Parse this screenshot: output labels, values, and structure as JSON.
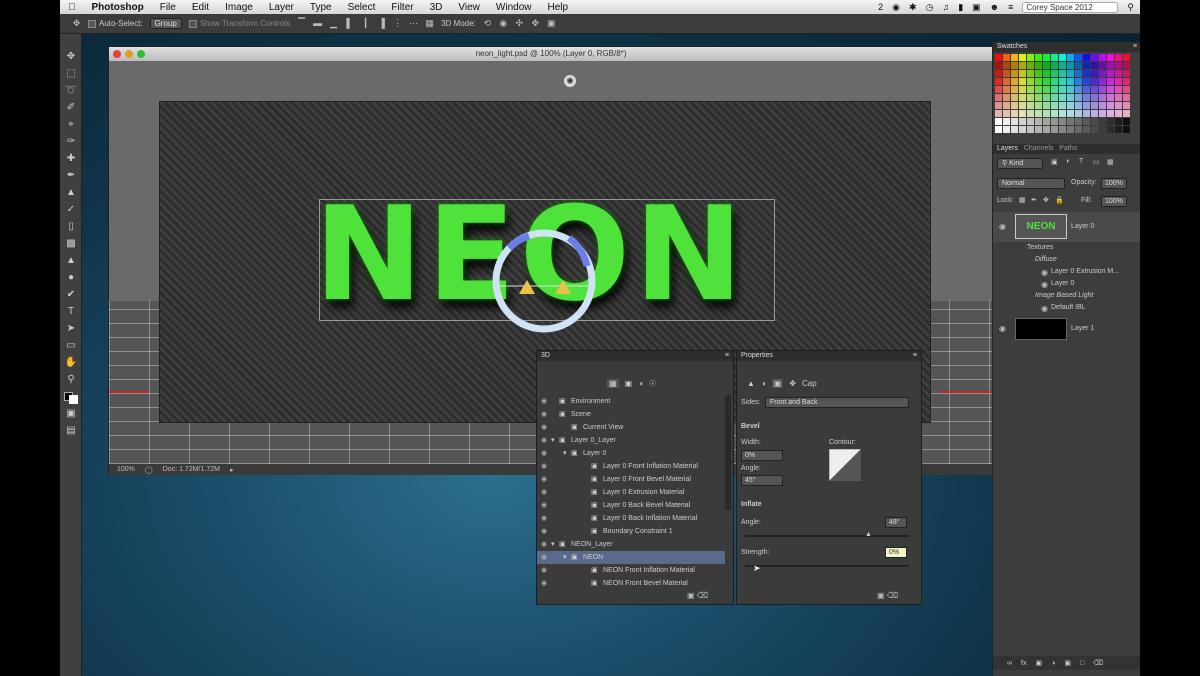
{
  "menubar": {
    "app": "Photoshop",
    "items": [
      "File",
      "Edit",
      "Image",
      "Layer",
      "Type",
      "Select",
      "Filter",
      "3D",
      "View",
      "Window",
      "Help"
    ],
    "badge": "2",
    "workspace": "Corey Space 2012"
  },
  "options": {
    "auto_select": "Auto-Select:",
    "group": "Group",
    "transform": "Show Transform Controls",
    "mode3d": "3D Mode:"
  },
  "document": {
    "title": "neon_light.psd @ 100% (Layer 0, RGB/8*)",
    "canvas_text": "NEON",
    "zoom": "100%",
    "doc_size": "Doc: 1.72M/1.72M"
  },
  "swatches": {
    "title": "Swatches"
  },
  "layers": {
    "tabs": [
      "Layers",
      "Channels",
      "Paths"
    ],
    "kind": "Kind",
    "blend": "Normal",
    "opacity_label": "Opacity:",
    "opacity": "100%",
    "lock_label": "Lock:",
    "fill_label": "Fill:",
    "fill": "100%",
    "rows": [
      {
        "name": "Layer 0",
        "thumb": "NEON"
      },
      {
        "name": "Textures"
      },
      {
        "name": "Diffuse"
      },
      {
        "name": "Layer 0 Extrusion M..."
      },
      {
        "name": "Layer 0"
      },
      {
        "name": "Image Based Light"
      },
      {
        "name": "Default IBL"
      },
      {
        "name": "Layer 1"
      }
    ]
  },
  "panel3d": {
    "title": "3D",
    "items": [
      "Environment",
      "Scene",
      "Current View",
      "Layer 0_Layer",
      "Layer 0",
      "Layer 0 Front Inflation Material",
      "Layer 0 Front Bevel Material",
      "Layer 0 Extrusion Material",
      "Layer 0 Back Bevel Material",
      "Layer 0 Back Inflation Material",
      "Boundary Constraint 1",
      "NEON_Layer",
      "NEON",
      "NEON Front Inflation Material",
      "NEON Front Bevel Material"
    ]
  },
  "properties": {
    "title": "Properties",
    "cap": "Cap",
    "sides_label": "Sides:",
    "sides": "Front and Back",
    "bevel": "Bevel",
    "width_label": "Width:",
    "width": "0%",
    "contour_label": "Contour:",
    "angle_label": "Angle:",
    "angle": "45°",
    "inflate": "Inflate",
    "inflate_angle_label": "Angle:",
    "inflate_angle": "48°",
    "strength_label": "Strength:",
    "strength": "0%"
  }
}
